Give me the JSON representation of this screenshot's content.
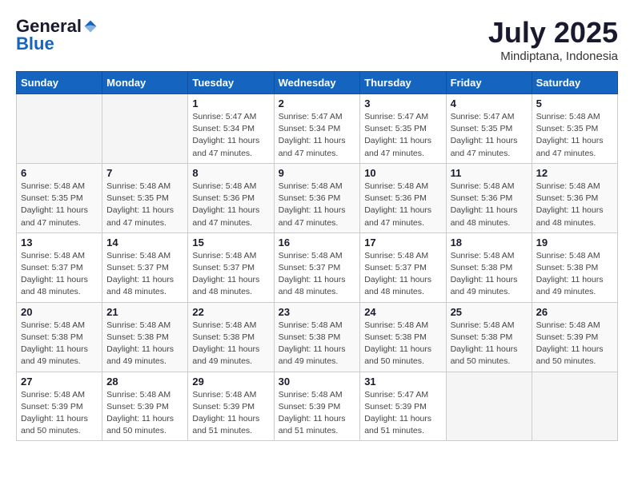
{
  "logo": {
    "general": "General",
    "blue": "Blue"
  },
  "title": "July 2025",
  "subtitle": "Mindiptana, Indonesia",
  "days_header": [
    "Sunday",
    "Monday",
    "Tuesday",
    "Wednesday",
    "Thursday",
    "Friday",
    "Saturday"
  ],
  "weeks": [
    [
      {
        "num": "",
        "info": ""
      },
      {
        "num": "",
        "info": ""
      },
      {
        "num": "1",
        "info": "Sunrise: 5:47 AM\nSunset: 5:34 PM\nDaylight: 11 hours and 47 minutes."
      },
      {
        "num": "2",
        "info": "Sunrise: 5:47 AM\nSunset: 5:34 PM\nDaylight: 11 hours and 47 minutes."
      },
      {
        "num": "3",
        "info": "Sunrise: 5:47 AM\nSunset: 5:35 PM\nDaylight: 11 hours and 47 minutes."
      },
      {
        "num": "4",
        "info": "Sunrise: 5:47 AM\nSunset: 5:35 PM\nDaylight: 11 hours and 47 minutes."
      },
      {
        "num": "5",
        "info": "Sunrise: 5:48 AM\nSunset: 5:35 PM\nDaylight: 11 hours and 47 minutes."
      }
    ],
    [
      {
        "num": "6",
        "info": "Sunrise: 5:48 AM\nSunset: 5:35 PM\nDaylight: 11 hours and 47 minutes."
      },
      {
        "num": "7",
        "info": "Sunrise: 5:48 AM\nSunset: 5:35 PM\nDaylight: 11 hours and 47 minutes."
      },
      {
        "num": "8",
        "info": "Sunrise: 5:48 AM\nSunset: 5:36 PM\nDaylight: 11 hours and 47 minutes."
      },
      {
        "num": "9",
        "info": "Sunrise: 5:48 AM\nSunset: 5:36 PM\nDaylight: 11 hours and 47 minutes."
      },
      {
        "num": "10",
        "info": "Sunrise: 5:48 AM\nSunset: 5:36 PM\nDaylight: 11 hours and 47 minutes."
      },
      {
        "num": "11",
        "info": "Sunrise: 5:48 AM\nSunset: 5:36 PM\nDaylight: 11 hours and 48 minutes."
      },
      {
        "num": "12",
        "info": "Sunrise: 5:48 AM\nSunset: 5:36 PM\nDaylight: 11 hours and 48 minutes."
      }
    ],
    [
      {
        "num": "13",
        "info": "Sunrise: 5:48 AM\nSunset: 5:37 PM\nDaylight: 11 hours and 48 minutes."
      },
      {
        "num": "14",
        "info": "Sunrise: 5:48 AM\nSunset: 5:37 PM\nDaylight: 11 hours and 48 minutes."
      },
      {
        "num": "15",
        "info": "Sunrise: 5:48 AM\nSunset: 5:37 PM\nDaylight: 11 hours and 48 minutes."
      },
      {
        "num": "16",
        "info": "Sunrise: 5:48 AM\nSunset: 5:37 PM\nDaylight: 11 hours and 48 minutes."
      },
      {
        "num": "17",
        "info": "Sunrise: 5:48 AM\nSunset: 5:37 PM\nDaylight: 11 hours and 48 minutes."
      },
      {
        "num": "18",
        "info": "Sunrise: 5:48 AM\nSunset: 5:38 PM\nDaylight: 11 hours and 49 minutes."
      },
      {
        "num": "19",
        "info": "Sunrise: 5:48 AM\nSunset: 5:38 PM\nDaylight: 11 hours and 49 minutes."
      }
    ],
    [
      {
        "num": "20",
        "info": "Sunrise: 5:48 AM\nSunset: 5:38 PM\nDaylight: 11 hours and 49 minutes."
      },
      {
        "num": "21",
        "info": "Sunrise: 5:48 AM\nSunset: 5:38 PM\nDaylight: 11 hours and 49 minutes."
      },
      {
        "num": "22",
        "info": "Sunrise: 5:48 AM\nSunset: 5:38 PM\nDaylight: 11 hours and 49 minutes."
      },
      {
        "num": "23",
        "info": "Sunrise: 5:48 AM\nSunset: 5:38 PM\nDaylight: 11 hours and 49 minutes."
      },
      {
        "num": "24",
        "info": "Sunrise: 5:48 AM\nSunset: 5:38 PM\nDaylight: 11 hours and 50 minutes."
      },
      {
        "num": "25",
        "info": "Sunrise: 5:48 AM\nSunset: 5:38 PM\nDaylight: 11 hours and 50 minutes."
      },
      {
        "num": "26",
        "info": "Sunrise: 5:48 AM\nSunset: 5:39 PM\nDaylight: 11 hours and 50 minutes."
      }
    ],
    [
      {
        "num": "27",
        "info": "Sunrise: 5:48 AM\nSunset: 5:39 PM\nDaylight: 11 hours and 50 minutes."
      },
      {
        "num": "28",
        "info": "Sunrise: 5:48 AM\nSunset: 5:39 PM\nDaylight: 11 hours and 50 minutes."
      },
      {
        "num": "29",
        "info": "Sunrise: 5:48 AM\nSunset: 5:39 PM\nDaylight: 11 hours and 51 minutes."
      },
      {
        "num": "30",
        "info": "Sunrise: 5:48 AM\nSunset: 5:39 PM\nDaylight: 11 hours and 51 minutes."
      },
      {
        "num": "31",
        "info": "Sunrise: 5:47 AM\nSunset: 5:39 PM\nDaylight: 11 hours and 51 minutes."
      },
      {
        "num": "",
        "info": ""
      },
      {
        "num": "",
        "info": ""
      }
    ]
  ]
}
